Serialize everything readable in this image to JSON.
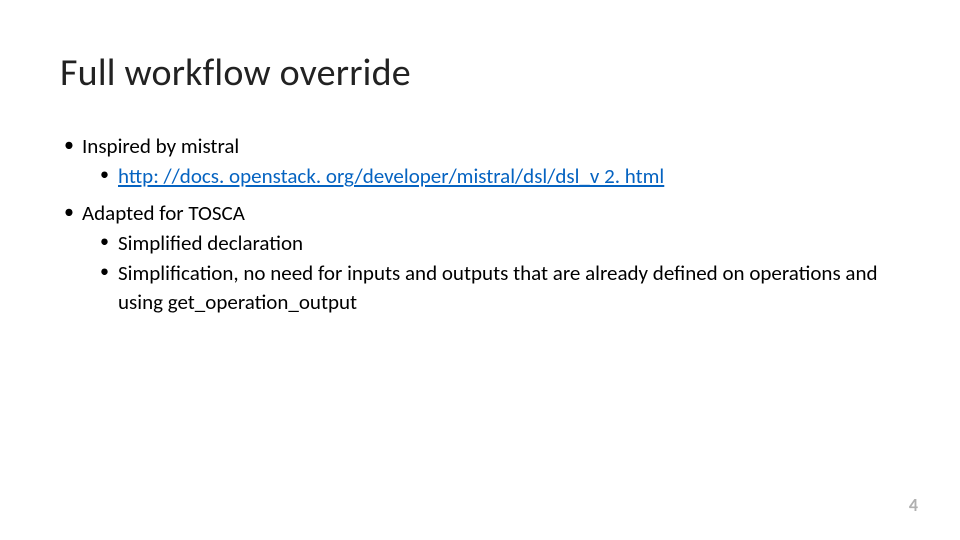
{
  "title": "Full workflow override",
  "bullets": {
    "b1": "Inspired by mistral",
    "b1_1_link": "http: //docs. openstack. org/developer/mistral/dsl/dsl_v 2. html",
    "b2": "Adapted for TOSCA",
    "b2_1": "Simplified declaration",
    "b2_2": "Simplification, no need for inputs and outputs that are already defined on operations and using get_operation_output"
  },
  "page_number": "4"
}
